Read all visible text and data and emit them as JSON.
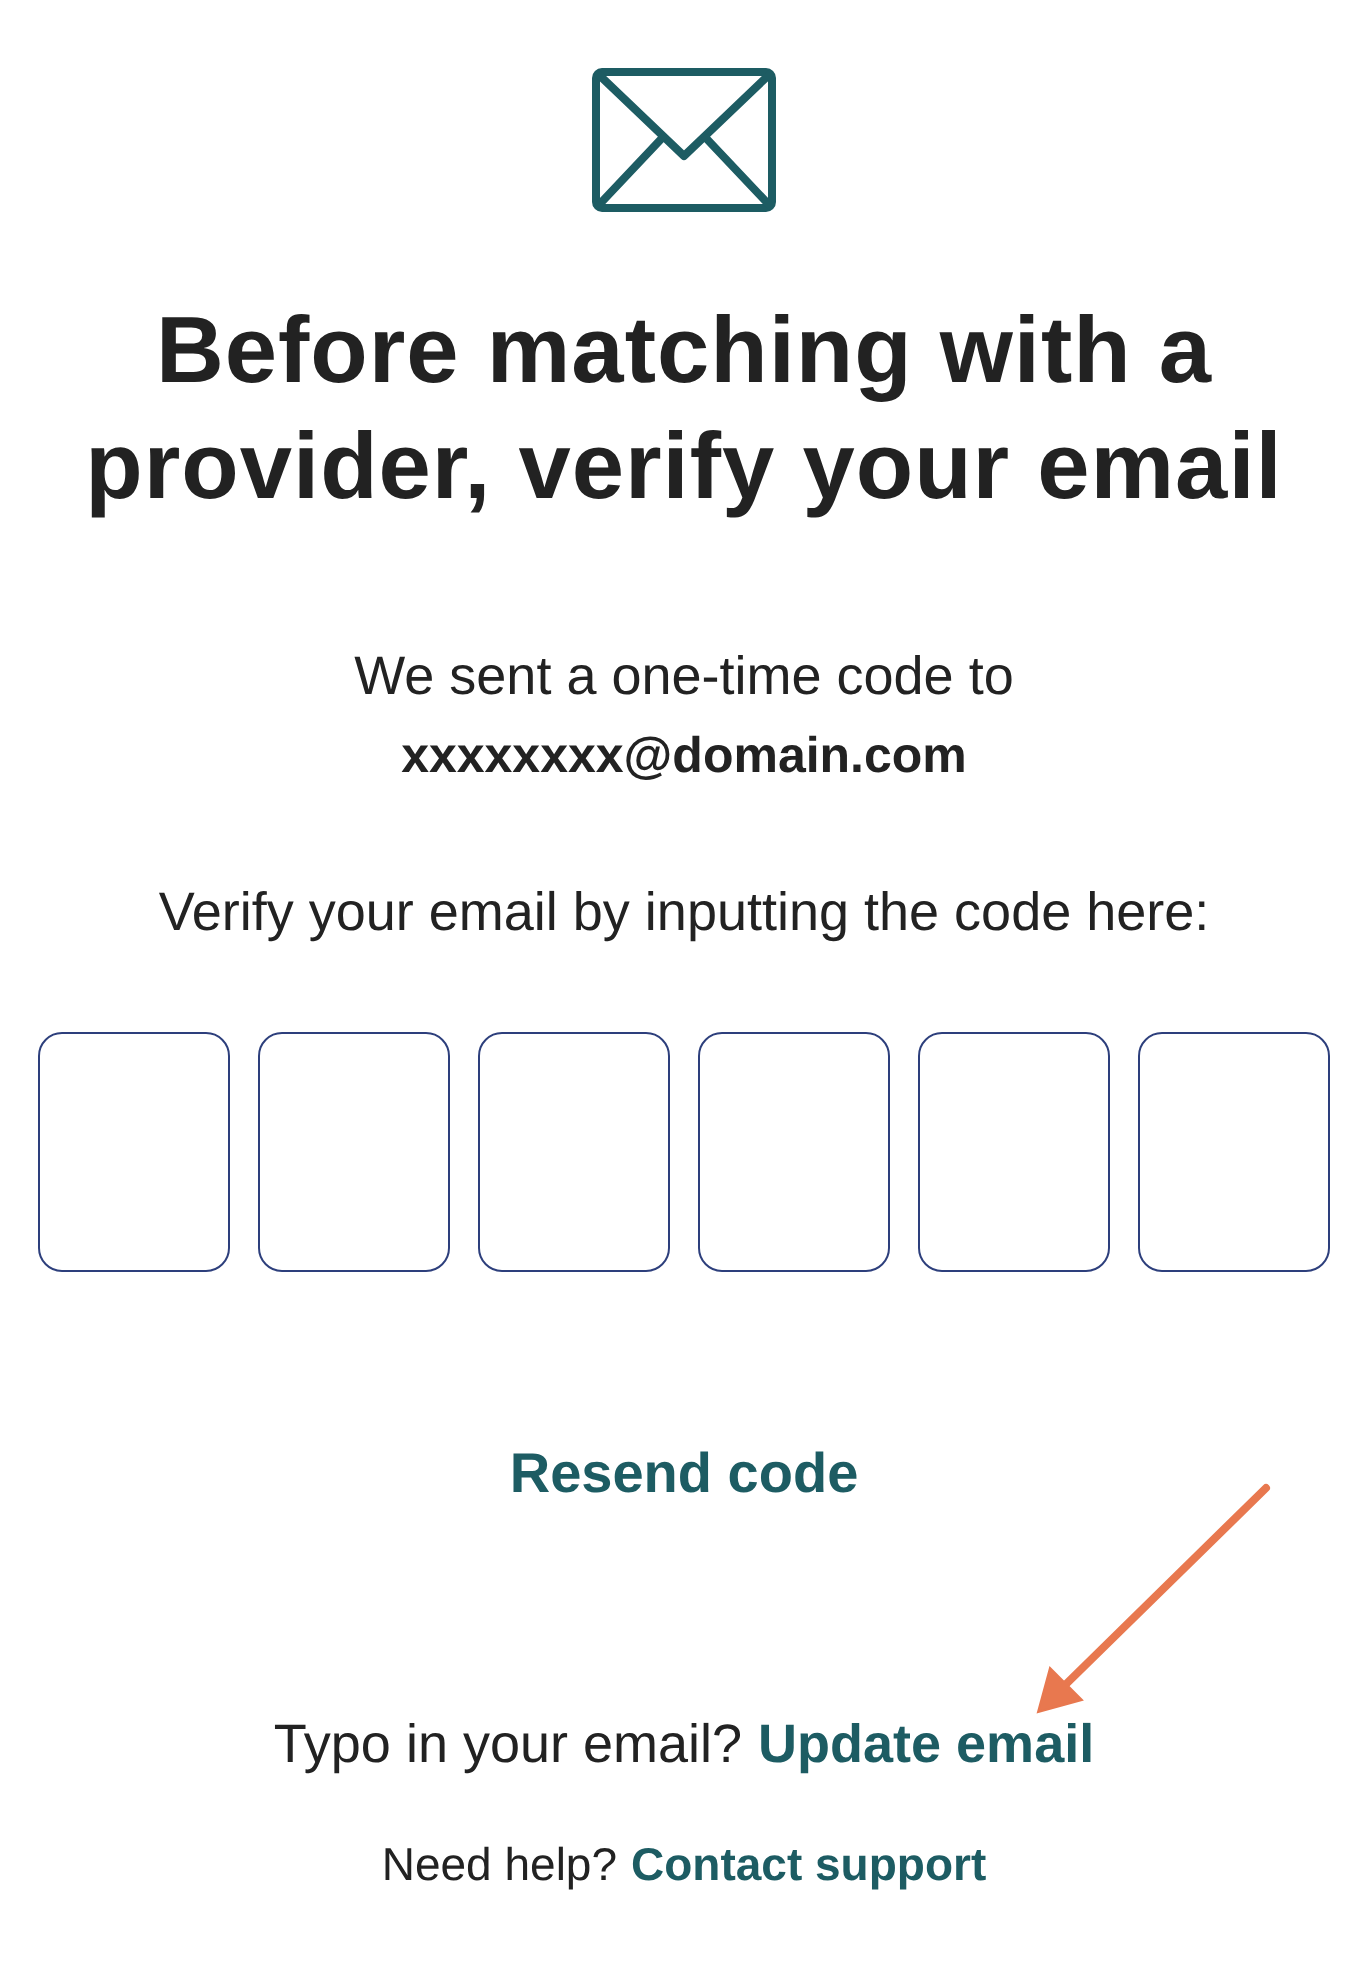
{
  "heading": "Before matching with a provider, verify your email",
  "sent_message": {
    "text": "We sent a one-time code to",
    "email": "xxxxxxxx@domain.com"
  },
  "instruction": "Verify your email by inputting the code here:",
  "code_fields": [
    {
      "kind": "digit"
    },
    {
      "kind": "digit"
    },
    {
      "kind": "digit"
    },
    {
      "kind": "digit"
    },
    {
      "kind": "digit"
    },
    {
      "kind": "digit"
    }
  ],
  "resend_link": "Resend code",
  "typo_line": {
    "text": "Typo in your email?",
    "link": "Update email"
  },
  "help_line": {
    "text": "Need help?",
    "link": "Contact support"
  },
  "annotation": {
    "kind": "arrow",
    "color": "#e8784f"
  }
}
